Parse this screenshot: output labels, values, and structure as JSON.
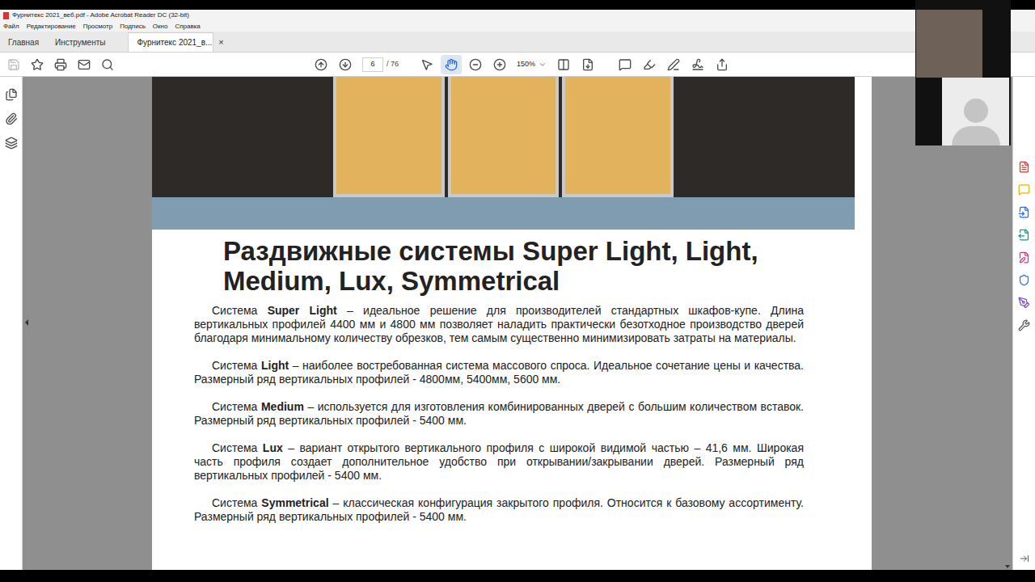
{
  "window": {
    "title": "Фурнитекс 2021_веб.pdf - Adobe Acrobat Reader DC (32-bit)"
  },
  "menu": [
    "Файл",
    "Редактирование",
    "Просмотр",
    "Подпись",
    "Окно",
    "Справка"
  ],
  "tabs": [
    {
      "label": "Главная",
      "selected": false,
      "closable": false
    },
    {
      "label": "Инструменты",
      "selected": false,
      "closable": false
    },
    {
      "label": "Фурнитекс 2021_в...",
      "selected": true,
      "closable": true
    }
  ],
  "tab_close": "×",
  "toolbar": {
    "page": "6",
    "page_count": "/ 76",
    "zoom": "150%",
    "hand_selected": true
  },
  "right_tools": [
    {
      "color": "#d9342b"
    },
    {
      "color": "#e8b400"
    },
    {
      "color": "#2d6fd6"
    },
    {
      "color": "#17928a"
    },
    {
      "color": "#d63384"
    },
    {
      "color": "#2d6fd6"
    },
    {
      "color": "#7b4fc4"
    },
    {
      "color": "#555555"
    }
  ],
  "document": {
    "heading": [
      "Раздвижные системы Super Light, Light,",
      "Medium, Lux, Symmetrical"
    ],
    "paragraphs": [
      {
        "prefix": "Система",
        "name": "Super Light",
        "text": "– идеальное решение для производителей стандартных шкафов-купе. Длина вертикальных профилей 4400 мм и 4800 мм позволяет наладить практически безотходное производство дверей благодаря минимальному количеству обрезков, тем самым существенно минимизировать затраты на материалы."
      },
      {
        "prefix": "Система",
        "name": "Light",
        "text": "– наиболее востребованная система массового спроса. Идеальное сочетание цены и качества. Размерный ряд вертикальных профилей - 4800мм, 5400мм, 5600 мм."
      },
      {
        "prefix": "Система",
        "name": "Medium",
        "text": "– используется для изготовления комбинированных дверей с большим количеством вставок. Размерный ряд вертикальных профилей - 5400 мм."
      },
      {
        "prefix": "Система",
        "name": "Lux",
        "text": "– вариант открытого вертикального профиля с широкой видимой частью – 41,6 мм. Широкая часть профиля создает дополнительное удобство при открывании/закрывании дверей. Размерный ряд вертикальных профилей - 5400 мм."
      },
      {
        "prefix": "Система",
        "name": "Symmetrical",
        "text": "– классическая конфигурация закрытого профиля. Относится к базовому ассортименту. Размерный ряд вертикальных профилей - 5400 мм."
      }
    ]
  }
}
